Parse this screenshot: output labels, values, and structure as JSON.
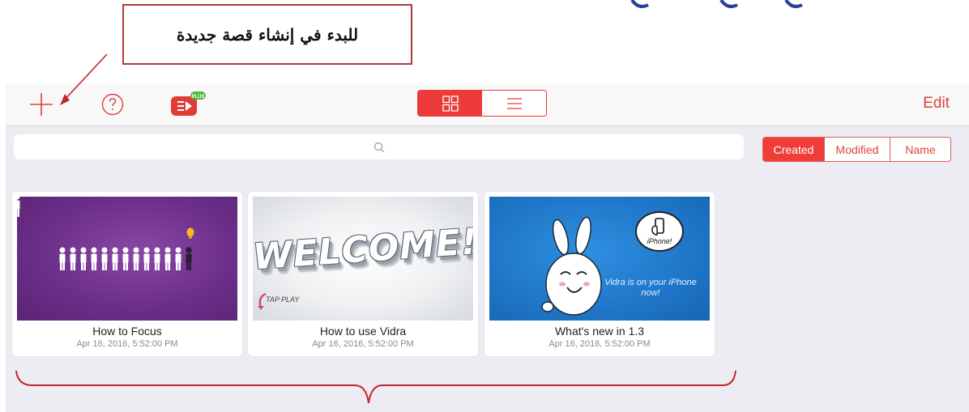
{
  "callout": {
    "text": "للبدء في إنشاء قصة جديدة"
  },
  "toolbar": {
    "add_icon": "plus-icon",
    "help_icon": "question-circle-icon",
    "logo_icon": "vidra-plus-logo",
    "logo_badge": "PLUS",
    "view_grid_icon": "grid-icon",
    "view_list_icon": "list-icon",
    "edit_label": "Edit"
  },
  "search": {
    "icon": "search-icon"
  },
  "sort": {
    "options": [
      "Created",
      "Modified",
      "Name"
    ],
    "selected": "Created"
  },
  "stories": [
    {
      "title": "How to Focus",
      "date": "Apr 16, 2016, 5:52:00 PM"
    },
    {
      "title": "How to use Vidra",
      "date": "Apr 16, 2016, 5:52:00 PM",
      "thumb_text": "WELCOME!",
      "thumb_sub": "TAP PLAY"
    },
    {
      "title": "What's new in 1.3",
      "date": "Apr 16, 2016, 5:52:00 PM",
      "thumb_badge": "iPhone!",
      "thumb_text": "Vidra is on your iPhone now!"
    }
  ],
  "colors": {
    "accent": "#ec3b38",
    "callout_border": "#b13a3a",
    "arrow": "#c1272d"
  }
}
